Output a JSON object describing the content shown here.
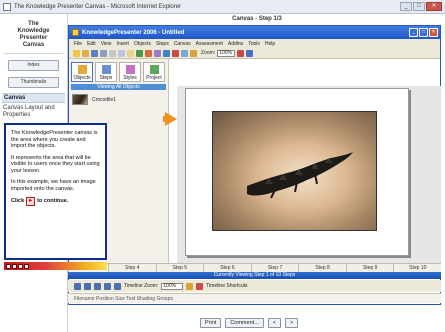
{
  "browser": {
    "title": "The Knowledge Presenter Canvas - Microsoft Internet Explorer"
  },
  "sidebar": {
    "logo_lines": [
      "The",
      "Knowledge",
      "Presenter",
      "Canvas"
    ],
    "buttons": [
      "Index",
      "Thumbnails"
    ],
    "section": "Canvas",
    "sub": "Canvas Layout and Properties"
  },
  "header": {
    "step_title": "Canvas - Step 1/3"
  },
  "app": {
    "title": "KnowledgePresenter 2006 - Untitled",
    "menu": [
      "File",
      "Edit",
      "View",
      "Insert",
      "Objects",
      "Steps",
      "Canvas",
      "Assessment",
      "Addins",
      "Tools",
      "Help"
    ],
    "zoom_label": "Zoom:",
    "zoom_value": "100%"
  },
  "palette": {
    "tabs": [
      "Objects",
      "Steps",
      "Styles",
      "Project"
    ],
    "strip": "Viewing All Objects",
    "item": "Crocodile1"
  },
  "info": {
    "p1": "The KnowledgePresenter canvas is the area where you create and import the objects.",
    "p2": "It represents the area that will be visible to users once they start using your lesson.",
    "p3": "In this example, we have an image imported onto the canvas.",
    "click_prefix": "Click",
    "click_suffix": "to continue."
  },
  "timeline": {
    "steps": [
      "Step 1",
      "Step 2",
      "Step 3",
      "Step 4",
      "Step 5",
      "Step 6",
      "Step 7",
      "Step 8",
      "Step 9",
      "Step 10"
    ]
  },
  "status": {
    "viewing": "Currently Viewing Step 1 of 10 Steps"
  },
  "bottom": {
    "timeline_zoom": "Timeline Zoom:",
    "zoom_value": "100%",
    "shortcuts": "Timeline Shortcuts"
  },
  "props": {
    "labels": "Filename  Position  Size  Text  Shading  Groups"
  },
  "footer": {
    "buttons": [
      "Print",
      "Comment...",
      "<",
      ">"
    ]
  }
}
